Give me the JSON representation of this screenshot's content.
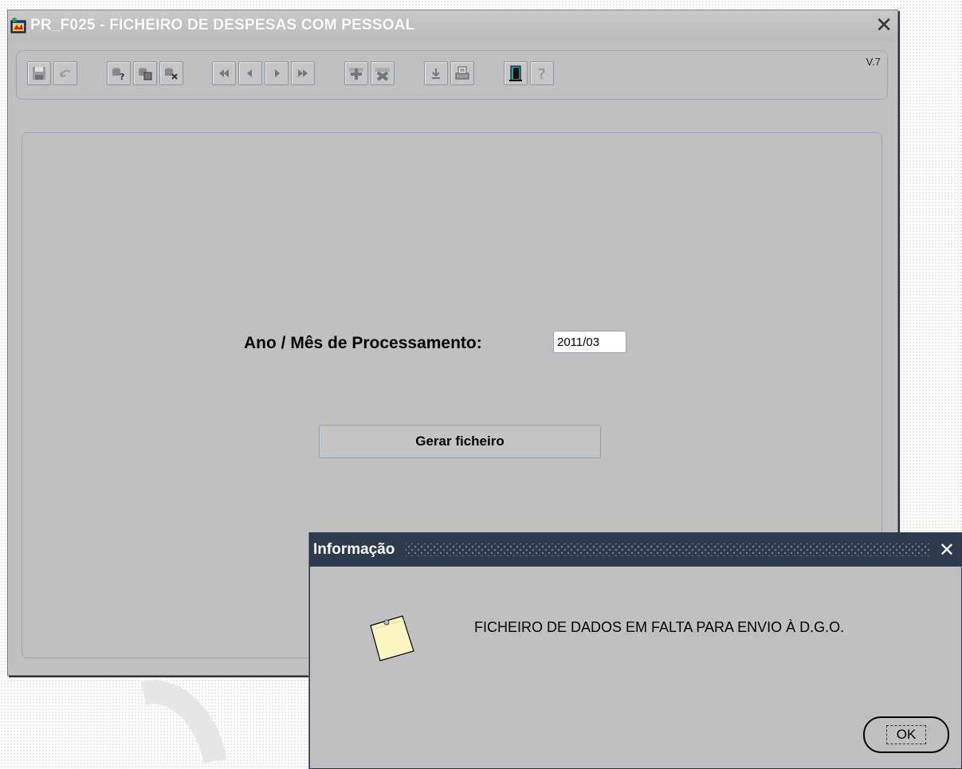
{
  "window": {
    "title": "PR_F025 - FICHEIRO DE DESPESAS COM PESSOAL",
    "close_glyph": "✕"
  },
  "toolbar": {
    "version": "V.7",
    "buttons": [
      {
        "name": "save-icon"
      },
      {
        "name": "undo-icon"
      },
      {
        "name": "query-icon"
      },
      {
        "name": "execute-query-icon"
      },
      {
        "name": "cancel-query-icon"
      },
      {
        "name": "first-record-icon"
      },
      {
        "name": "previous-record-icon"
      },
      {
        "name": "next-record-icon"
      },
      {
        "name": "last-record-icon"
      },
      {
        "name": "insert-record-icon"
      },
      {
        "name": "delete-record-icon"
      },
      {
        "name": "download-icon"
      },
      {
        "name": "print-icon"
      },
      {
        "name": "exit-door-icon"
      },
      {
        "name": "help-icon"
      }
    ]
  },
  "form": {
    "field_label": "Ano / Mês de Processamento:",
    "field_value": "2011/03",
    "generate_button": "Gerar ficheiro"
  },
  "dialog": {
    "title": "Informação",
    "message": "FICHEIRO DE DADOS EM FALTA PARA ENVIO À D.G.O.",
    "ok_label": "OK",
    "close_glyph": "✕"
  }
}
